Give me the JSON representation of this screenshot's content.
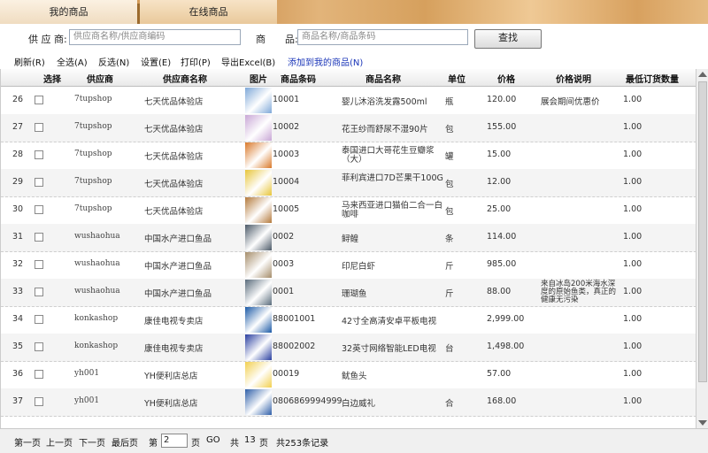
{
  "tabs": [
    {
      "label": "我的商品"
    },
    {
      "label": "在线商品"
    }
  ],
  "search": {
    "supplier_label": "供 应 商:",
    "supplier_placeholder": "供应商名称/供应商编码",
    "product_label": "商　　品:",
    "product_placeholder": "商品名称/商品条码",
    "search_button": "查找"
  },
  "toolbar": {
    "refresh": "刷新(R)",
    "select_all": "全选(A)",
    "invert": "反选(N)",
    "settings": "设置(E)",
    "print": "打印(P)",
    "export": "导出Excel(B)",
    "add_to_mine": "添加到我的商品(N)"
  },
  "columns": {
    "select": "选择",
    "supplier": "供应商",
    "supplier_name": "供应商名称",
    "image": "图片",
    "barcode": "商品条码",
    "product_name": "商品名称",
    "unit": "单位",
    "price": "价格",
    "price_note": "价格说明",
    "min_qty": "最低订货数量"
  },
  "rows": [
    {
      "no": "26",
      "supplier": "7tupshop",
      "supplier_name": "七天优品体验店",
      "barcode": "10001",
      "product_name": "婴儿沐浴洗发露500ml",
      "unit": "瓶",
      "price": "120.00",
      "price_note": "展会期间优惠价",
      "min_qty": "1.00",
      "img": "bottle"
    },
    {
      "no": "27",
      "supplier": "7tupshop",
      "supplier_name": "七天优品体验店",
      "barcode": "10002",
      "product_name": "花王纱而舒尿不湿90片",
      "unit": "包",
      "price": "155.00",
      "price_note": "",
      "min_qty": "1.00",
      "img": "diaper"
    },
    {
      "no": "28",
      "supplier": "7tupshop",
      "supplier_name": "七天优品体验店",
      "barcode": "10003",
      "product_name": "泰国进口大哥花生豆瓣浆（大）",
      "unit": "罐",
      "price": "15.00",
      "price_note": "",
      "min_qty": "1.00",
      "img": "cans"
    },
    {
      "no": "29",
      "supplier": "7tupshop",
      "supplier_name": "七天优品体验店",
      "barcode": "10004",
      "product_name": "菲利宾进口7D芒果干100G",
      "unit": "包",
      "price": "12.00",
      "price_note": "",
      "min_qty": "1.00",
      "img": "mango"
    },
    {
      "no": "30",
      "supplier": "7tupshop",
      "supplier_name": "七天优品体验店",
      "barcode": "10005",
      "product_name": "马来西亚进口猫伯二合一白咖啡",
      "unit": "包",
      "price": "25.00",
      "price_note": "",
      "min_qty": "1.00",
      "img": "coffee"
    },
    {
      "no": "31",
      "supplier": "wushaohua",
      "supplier_name": "中国水产进口鱼品",
      "barcode": "0002",
      "product_name": "鲟鳇",
      "unit": "条",
      "price": "114.00",
      "price_note": "",
      "min_qty": "1.00",
      "img": "fish1"
    },
    {
      "no": "32",
      "supplier": "wushaohua",
      "supplier_name": "中国水产进口鱼品",
      "barcode": "0003",
      "product_name": "印尼白虾",
      "unit": "斤",
      "price": "985.00",
      "price_note": "",
      "min_qty": "1.00",
      "img": "shrimp"
    },
    {
      "no": "33",
      "supplier": "wushaohua",
      "supplier_name": "中国水产进口鱼品",
      "barcode": "0001",
      "product_name": "珊瑚鱼",
      "unit": "斤",
      "price": "88.00",
      "price_note": "来自冰岛200米海水深度的原始鱼类，真正的健康无污染",
      "min_qty": "1.00",
      "img": "fish2"
    },
    {
      "no": "34",
      "supplier": "konkashop",
      "supplier_name": "康佳电视专卖店",
      "barcode": "88001001",
      "product_name": "42寸全高清安卓平板电视",
      "unit": "",
      "price": "2,999.00",
      "price_note": "",
      "min_qty": "1.00",
      "img": "tv1"
    },
    {
      "no": "35",
      "supplier": "konkashop",
      "supplier_name": "康佳电视专卖店",
      "barcode": "88002002",
      "product_name": "32英寸网络智能LED电视",
      "unit": "台",
      "price": "1,498.00",
      "price_note": "",
      "min_qty": "1.00",
      "img": "tv2"
    },
    {
      "no": "36",
      "supplier": "yh001",
      "supplier_name": "YH便利店总店",
      "barcode": "00019",
      "product_name": "鱿鱼头",
      "unit": "",
      "price": "57.00",
      "price_note": "",
      "min_qty": "1.00",
      "img": "sign"
    },
    {
      "no": "37",
      "supplier": "yh001",
      "supplier_name": "YH便利店总店",
      "barcode": "0806869994999",
      "product_name": "白边威礼",
      "unit": "合",
      "price": "168.00",
      "price_note": "",
      "min_qty": "1.00",
      "img": "box"
    }
  ],
  "pager": {
    "first": "第一页",
    "prev": "上一页",
    "next": "下一页",
    "last": "最后页",
    "page_prefix": "第",
    "page_value": "2",
    "page_suffix": "页",
    "go": "GO",
    "total_prefix": "共",
    "total_pages": "13",
    "total_suffix": "页",
    "records": "共253条记录"
  },
  "image_colors": {
    "bottle": "#7fa8d8",
    "diaper": "#c9a7d6",
    "cans": "#d9792a",
    "mango": "#e7c53a",
    "coffee": "#b47a3c",
    "fish1": "#4c5a68",
    "shrimp": "#a58d6a",
    "fish2": "#5a6c7c",
    "tv1": "#1c5aa6",
    "tv2": "#2a3fa0",
    "sign": "#f2d050",
    "box": "#2f5fa8"
  }
}
